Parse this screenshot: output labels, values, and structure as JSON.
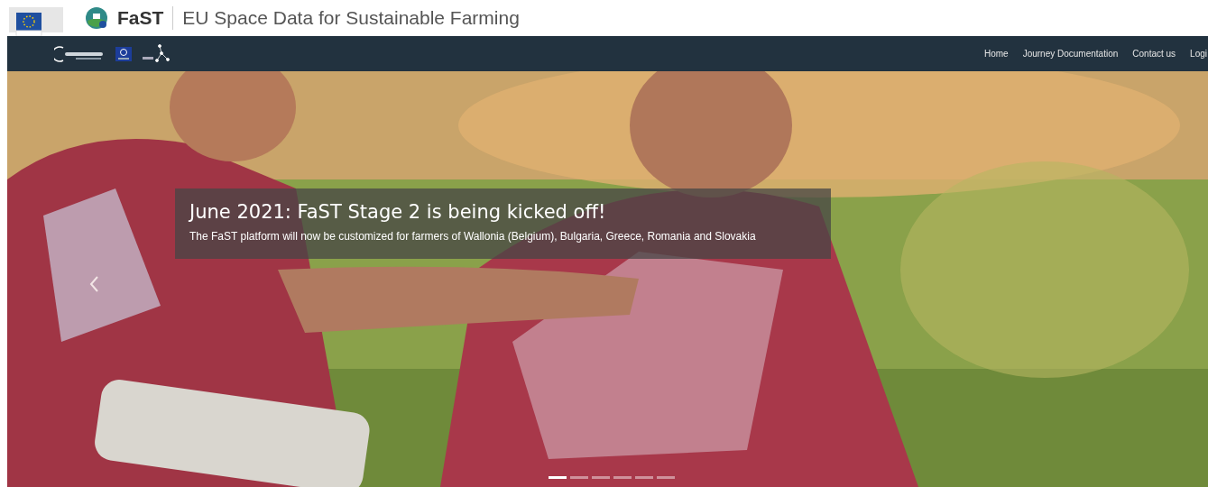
{
  "header": {
    "brand": "FaST",
    "tagline": "EU Space Data for Sustainable Farming"
  },
  "nav": {
    "links": [
      {
        "label": "Home"
      },
      {
        "label": "Journey Documentation"
      },
      {
        "label": "Contact us"
      },
      {
        "label": "Logi"
      }
    ]
  },
  "carousel": {
    "caption": {
      "title": "June 2021: FaST Stage 2 is being kicked off!",
      "text": "The FaST platform will now be customized for farmers of Wallonia (Belgium), Bulgaria, Greece, Romania and Slovakia"
    },
    "indicators": [
      {
        "selected": true
      },
      {
        "selected": false
      },
      {
        "selected": false
      },
      {
        "selected": false
      },
      {
        "selected": false
      },
      {
        "selected": false
      }
    ]
  }
}
